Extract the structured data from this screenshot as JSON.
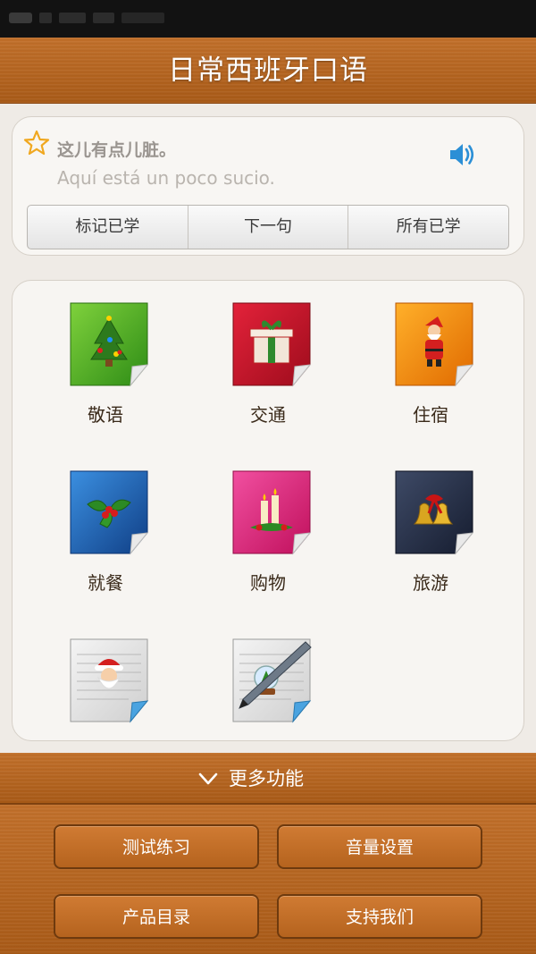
{
  "header": {
    "title": "日常西班牙口语"
  },
  "phrase": {
    "chinese": "这儿有点儿脏。",
    "spanish": "Aquí está un poco sucio.",
    "actions": [
      "标记已学",
      "下一句",
      "所有已学"
    ]
  },
  "categories": [
    {
      "label": "敬语",
      "icon": "christmas-tree-icon",
      "color": "#3aa11e"
    },
    {
      "label": "交通",
      "icon": "gift-icon",
      "color": "#c5142a"
    },
    {
      "label": "住宿",
      "icon": "santa-icon",
      "color": "#f08a00"
    },
    {
      "label": "就餐",
      "icon": "holly-icon",
      "color": "#1c5fb0"
    },
    {
      "label": "购物",
      "icon": "candles-icon",
      "color": "#e0287a"
    },
    {
      "label": "旅游",
      "icon": "bells-icon",
      "color": "#2a3550"
    },
    {
      "label": "",
      "icon": "santa-notepad-icon",
      "color": "#dcdcdc"
    },
    {
      "label": "",
      "icon": "snow-globe-pen-icon",
      "color": "#dcdcdc"
    }
  ],
  "more": {
    "label": "更多功能"
  },
  "bottom_buttons": [
    "测试练习",
    "音量设置",
    "产品目录",
    "支持我们"
  ]
}
